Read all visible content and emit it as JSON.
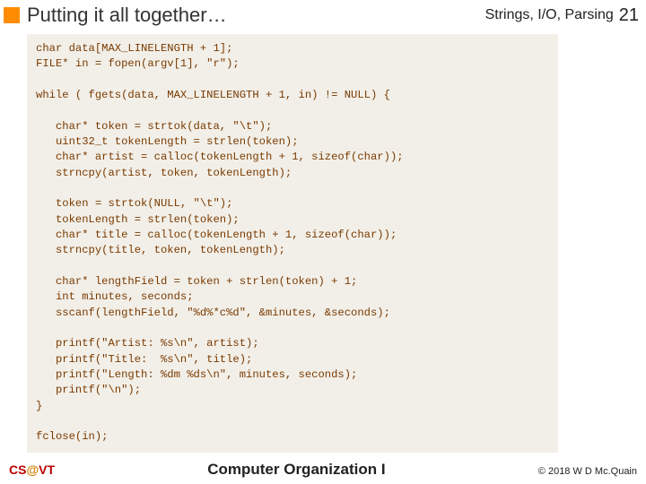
{
  "header": {
    "title": "Putting it all together…",
    "section": "Strings, I/O, Parsing",
    "page": "21"
  },
  "code": "char data[MAX_LINELENGTH + 1];\nFILE* in = fopen(argv[1], \"r\");\n\nwhile ( fgets(data, MAX_LINELENGTH + 1, in) != NULL) {\n\n   char* token = strtok(data, \"\\t\");\n   uint32_t tokenLength = strlen(token);\n   char* artist = calloc(tokenLength + 1, sizeof(char));\n   strncpy(artist, token, tokenLength);\n\n   token = strtok(NULL, \"\\t\");\n   tokenLength = strlen(token);\n   char* title = calloc(tokenLength + 1, sizeof(char));\n   strncpy(title, token, tokenLength);\n\n   char* lengthField = token + strlen(token) + 1;\n   int minutes, seconds;\n   sscanf(lengthField, \"%d%*c%d\", &minutes, &seconds);\n\n   printf(\"Artist: %s\\n\", artist);\n   printf(\"Title:  %s\\n\", title);\n   printf(\"Length: %dm %ds\\n\", minutes, seconds);\n   printf(\"\\n\");\n}\n\nfclose(in);",
  "footer": {
    "left_cs": "CS",
    "left_at": "@",
    "left_vt": "VT",
    "center": "Computer Organization I",
    "right": "© 2018 W D Mc.Quain"
  }
}
